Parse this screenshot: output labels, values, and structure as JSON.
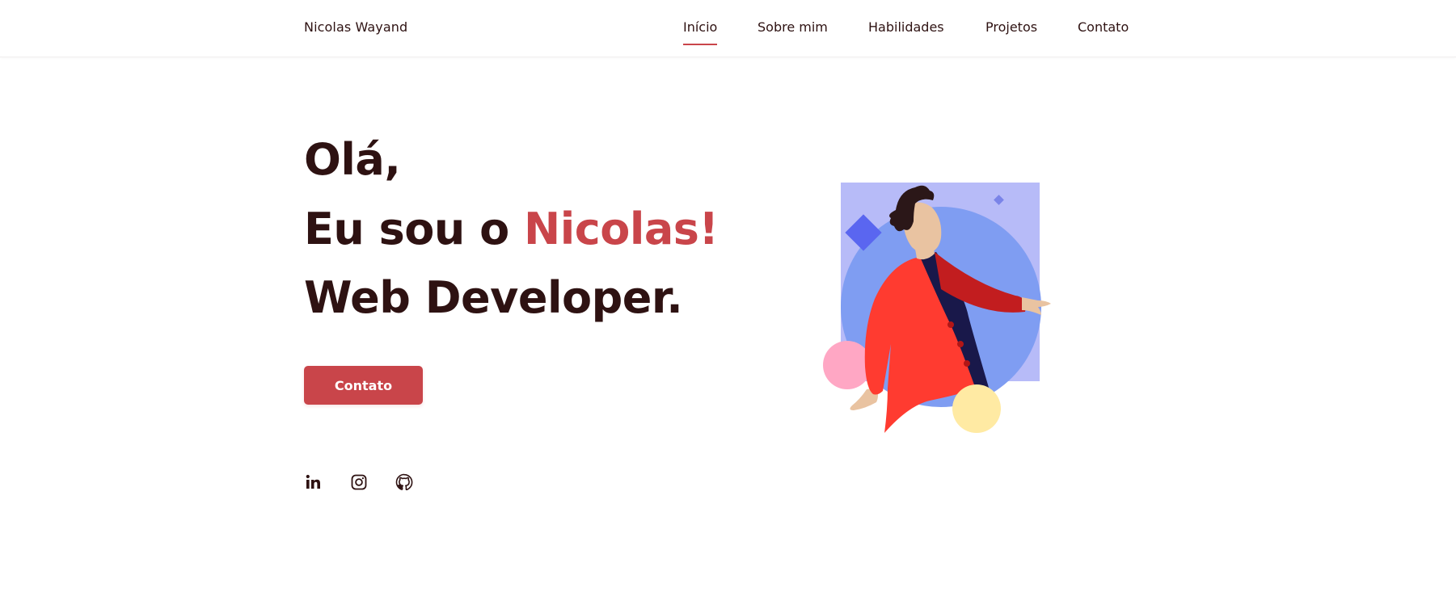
{
  "header": {
    "brand": "Nicolas Wayand",
    "nav": [
      {
        "label": "Início",
        "active": true
      },
      {
        "label": "Sobre mim",
        "active": false
      },
      {
        "label": "Habilidades",
        "active": false
      },
      {
        "label": "Projetos",
        "active": false
      },
      {
        "label": "Contato",
        "active": false
      }
    ]
  },
  "hero": {
    "greeting": "Olá,",
    "intro_prefix": "Eu sou o ",
    "intro_name": "Nicolas!",
    "role": "Web Developer.",
    "cta_label": "Contato"
  },
  "social": [
    {
      "icon": "linkedin-icon"
    },
    {
      "icon": "instagram-icon"
    },
    {
      "icon": "github-icon"
    }
  ],
  "colors": {
    "text": "#2e1212",
    "accent": "#c9454a",
    "background": "#ffffff"
  }
}
